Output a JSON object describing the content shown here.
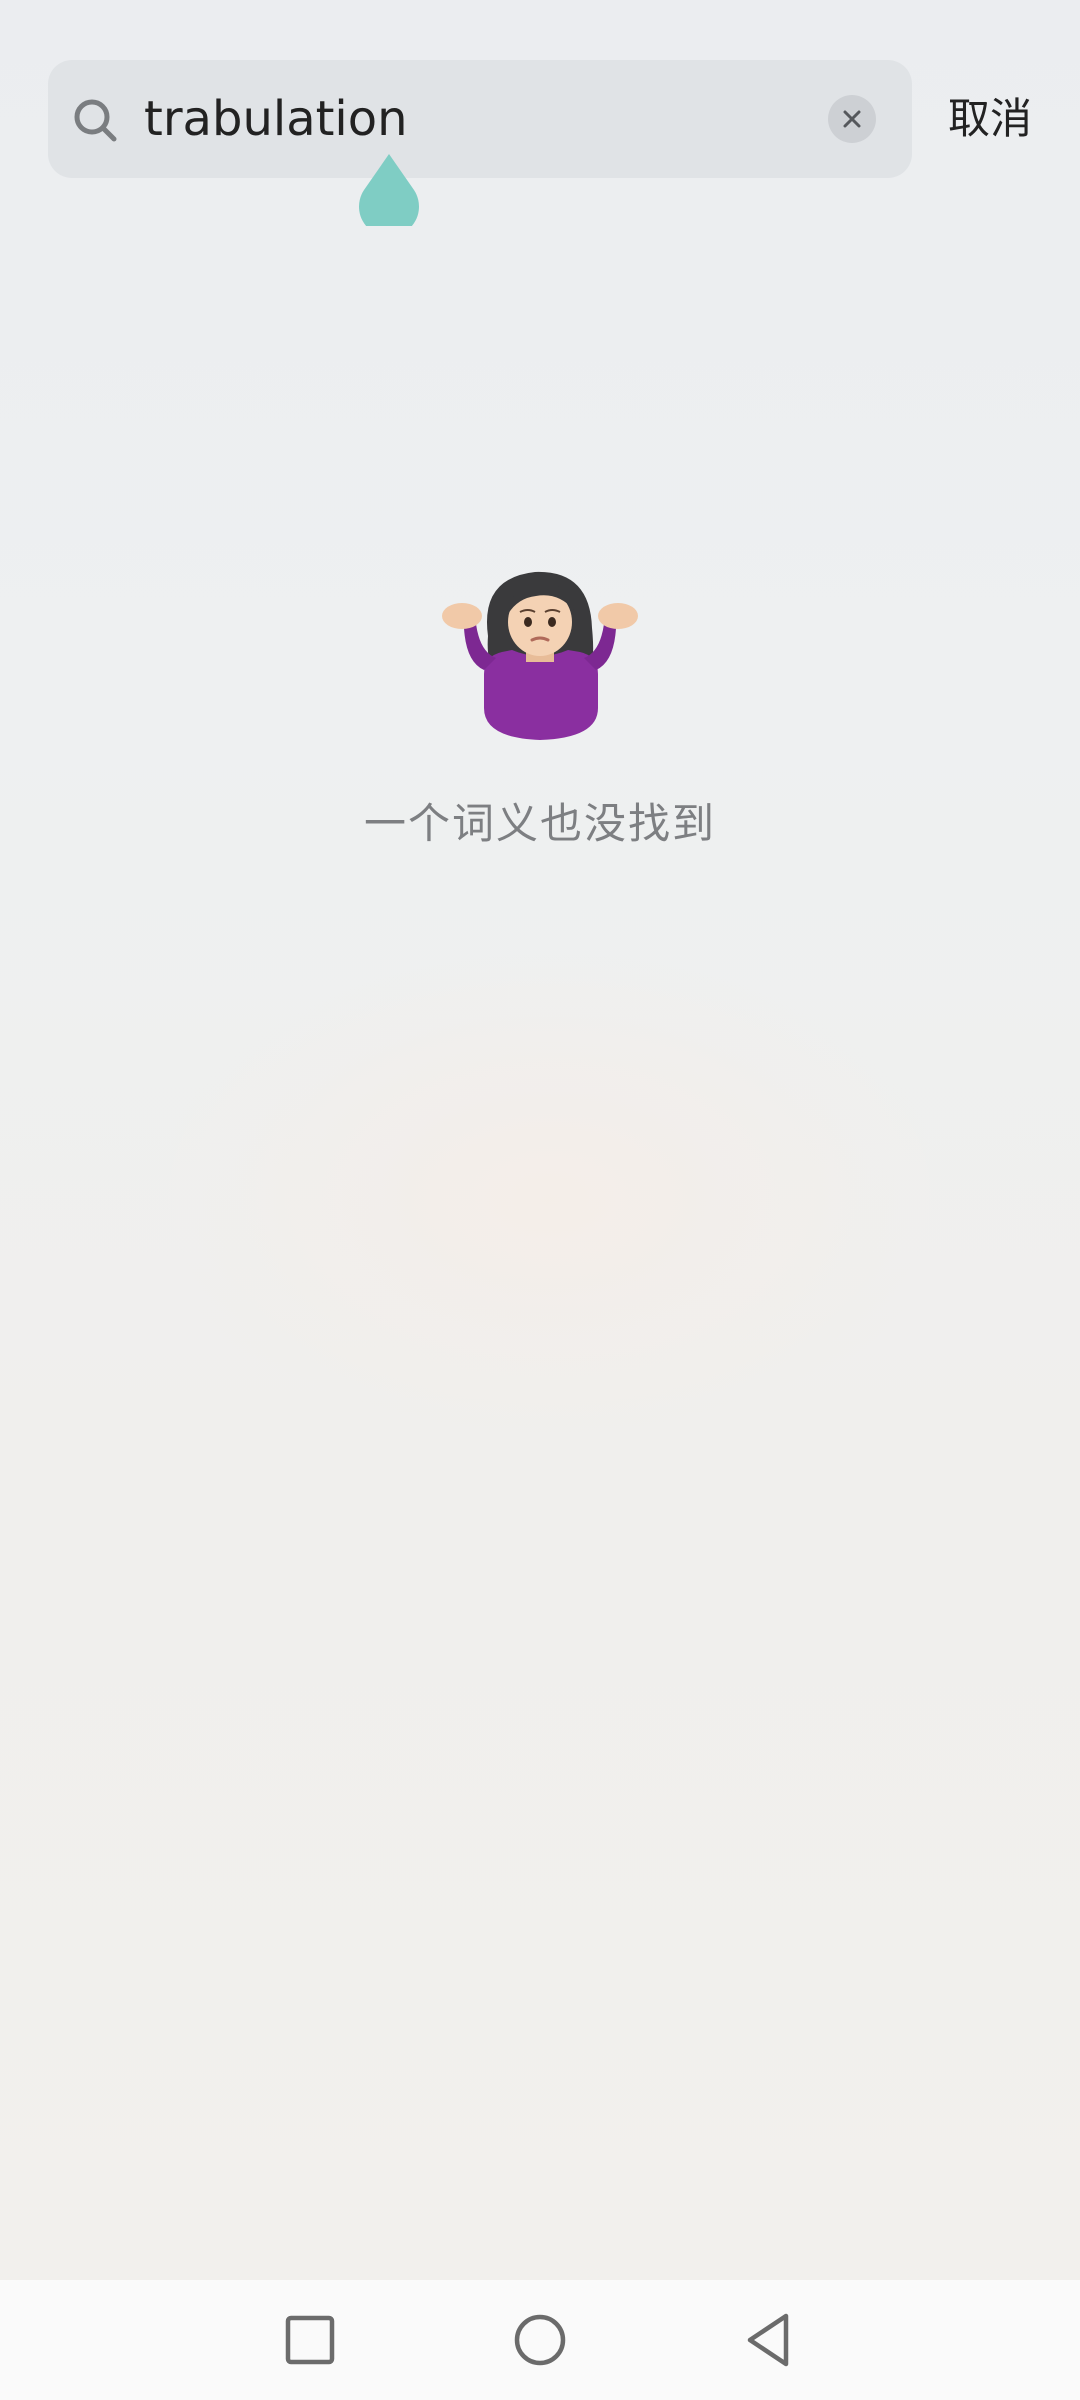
{
  "search": {
    "query": "trabulation",
    "cancel_label": "取消"
  },
  "empty_state": {
    "message": "一个词义也没找到",
    "emoji": "person-shrugging-emoji"
  },
  "icons": {
    "search": "search-icon",
    "clear": "clear-icon",
    "cursor_handle": "text-cursor-handle",
    "nav_recents": "square-icon",
    "nav_home": "circle-icon",
    "nav_back": "triangle-back-icon"
  },
  "colors": {
    "search_bg": "#e0e3e6",
    "cursor_handle": "#7fcdc4",
    "empty_text": "#7d7f82",
    "nav_bar_bg": "#fafafa"
  }
}
